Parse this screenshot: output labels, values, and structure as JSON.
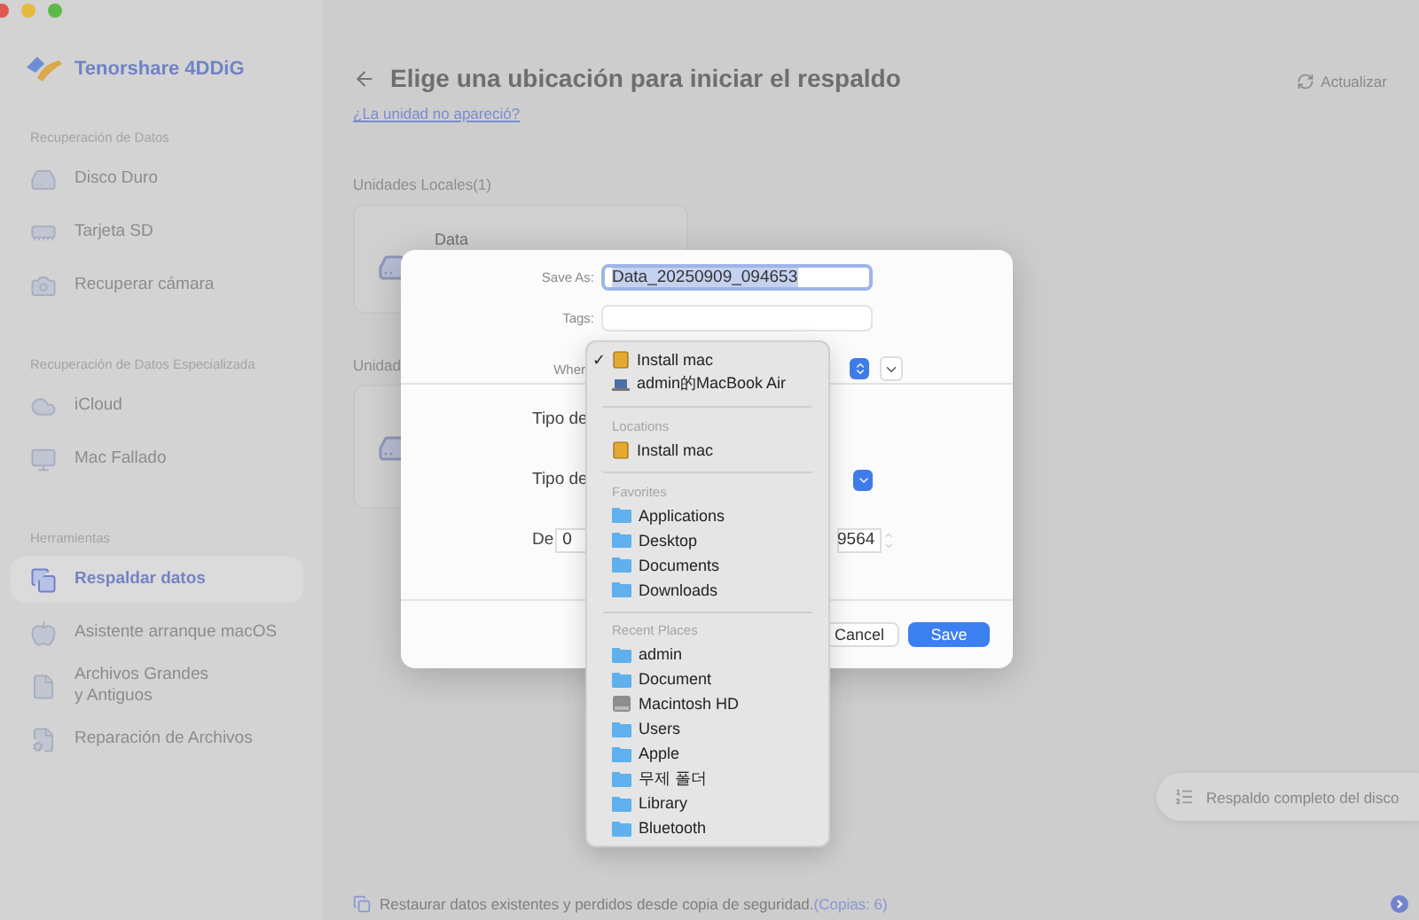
{
  "app": {
    "name": "Tenorshare 4DDiG"
  },
  "sidebar": {
    "sections": [
      {
        "title": "Recuperación de Datos",
        "items": [
          {
            "label": "Disco Duro",
            "kind": "drive",
            "selected": false
          },
          {
            "label": "Tarjeta SD",
            "kind": "sd",
            "selected": false
          },
          {
            "label": "Recuperar cámara",
            "kind": "camera",
            "selected": false
          }
        ]
      },
      {
        "title": "Recuperación de Datos Especializada",
        "items": [
          {
            "label": "iCloud",
            "kind": "cloud",
            "selected": false
          },
          {
            "label": "Mac Fallado",
            "kind": "mac",
            "selected": false
          }
        ]
      },
      {
        "title": "Herramientas",
        "items": [
          {
            "label": "Respaldar datos",
            "kind": "backup",
            "selected": true
          },
          {
            "label": "Asistente arranque macOS",
            "kind": "apple",
            "selected": false
          },
          {
            "label": "Archivos Grandes\ny Antiguos",
            "kind": "file",
            "selected": false
          },
          {
            "label": "Reparación de Archivos",
            "kind": "repair",
            "selected": false
          }
        ]
      }
    ]
  },
  "header": {
    "title": "Elige una ubicación para iniciar el respaldo",
    "refresh": "Actualizar",
    "link": "¿La unidad no apareció?"
  },
  "drives": {
    "local_label": "Unidades Locales(1)",
    "local_card": {
      "name": "Data"
    },
    "second_label": "Unidad"
  },
  "dialog": {
    "save_as": {
      "label": "Save As:",
      "value": "Data_20250909_094653"
    },
    "tags": {
      "label": "Tags:"
    },
    "where": {
      "label": "Wher"
    },
    "options": [
      {
        "kind": "plain",
        "label": "Tipo de"
      },
      {
        "kind": "select",
        "label": "Tipo de"
      },
      {
        "kind": "range",
        "label": "De",
        "from": "0",
        "to": "9564"
      }
    ],
    "buttons": [
      {
        "kind": "secondary",
        "label": "Cancel"
      },
      {
        "kind": "primary",
        "label": "Save"
      }
    ]
  },
  "menu": {
    "check_mark": "✓",
    "sections": [
      {
        "items": [
          {
            "label": "Install mac",
            "kind": "drive",
            "checked": true
          },
          {
            "label": "admin的MacBook Air",
            "kind": "laptop",
            "checked": false
          }
        ]
      },
      {
        "header": "Locations",
        "items": [
          {
            "label": "Install mac",
            "kind": "drive",
            "checked": false
          }
        ]
      },
      {
        "header": "Favorites",
        "items": [
          {
            "label": "Applications",
            "kind": "folder",
            "checked": false
          },
          {
            "label": "Desktop",
            "kind": "folder",
            "checked": false
          },
          {
            "label": "Documents",
            "kind": "folder",
            "checked": false
          },
          {
            "label": "Downloads",
            "kind": "folder",
            "checked": false
          }
        ]
      },
      {
        "header": "Recent Places",
        "items": [
          {
            "label": "admin",
            "kind": "folder",
            "checked": false
          },
          {
            "label": "Document",
            "kind": "folder",
            "checked": false
          },
          {
            "label": "Macintosh HD",
            "kind": "disk",
            "checked": false
          },
          {
            "label": "Users",
            "kind": "folder",
            "checked": false
          },
          {
            "label": "Apple",
            "kind": "folder",
            "checked": false
          },
          {
            "label": "무제 폴더",
            "kind": "folder",
            "checked": false
          },
          {
            "label": "Library",
            "kind": "folder",
            "checked": false
          },
          {
            "label": "Bluetooth",
            "kind": "folder",
            "checked": false
          }
        ]
      }
    ]
  },
  "floating_button": "Respaldo completo del disco",
  "footer": {
    "text": "Restaurar datos existentes y perdidos desde copia de seguridad.",
    "copies": "(Copias: 6)"
  }
}
